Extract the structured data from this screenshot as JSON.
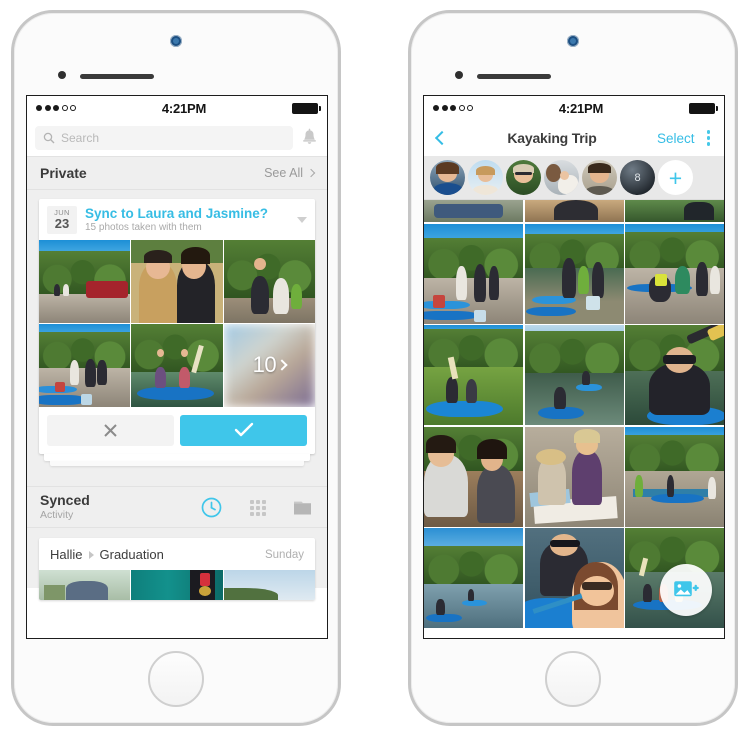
{
  "left_phone": {
    "status_bar": {
      "signal_dots_filled": 3,
      "signal_dots_total": 5,
      "time": "4:21PM"
    },
    "search": {
      "placeholder": "Search",
      "value": "",
      "icon": "search-icon"
    },
    "notifications_icon": "bell-icon",
    "private_section": {
      "title": "Private",
      "see_all_label": "See All"
    },
    "sync_card": {
      "date_month": "JUN",
      "date_day": "23",
      "title": "Sync to Laura and Jasmine?",
      "subtitle": "15 photos taken with them",
      "collapse_icon": "chevron-down-icon",
      "more_count": "10",
      "dismiss_icon": "close-icon",
      "confirm_icon": "check-icon",
      "confirm_color": "#3fc6ea"
    },
    "synced_section": {
      "title": "Synced",
      "subtitle": "Activity",
      "views": [
        {
          "name": "recent-activity",
          "icon": "clock-icon",
          "active": true,
          "color": "#3fc6ea"
        },
        {
          "name": "grid-view",
          "icon": "grid-icon",
          "active": false,
          "color": "#c4c4c4"
        },
        {
          "name": "albums-view",
          "icon": "album-icon",
          "active": false,
          "color": "#b6b6b6"
        }
      ]
    },
    "activity_item": {
      "owner": "Hallie",
      "album": "Graduation",
      "day": "Sunday"
    }
  },
  "right_phone": {
    "status_bar": {
      "signal_dots_filled": 3,
      "signal_dots_total": 5,
      "time": "4:21PM"
    },
    "nav": {
      "back_icon": "chevron-left-icon",
      "title": "Kayaking Trip",
      "select_label": "Select",
      "overflow_icon": "kebab-menu-icon",
      "accent_color": "#35bde5"
    },
    "participants": {
      "avatars": [
        {
          "name": "avatar-1"
        },
        {
          "name": "avatar-2"
        },
        {
          "name": "avatar-3"
        },
        {
          "name": "avatar-4"
        },
        {
          "name": "avatar-5"
        }
      ],
      "overflow_count": "8",
      "add_label": "+"
    },
    "add_photo_fab": {
      "icon": "add-photo-icon",
      "color": "#3fc6ea"
    },
    "photo_grid": {
      "columns": 3,
      "rows": 5
    }
  }
}
